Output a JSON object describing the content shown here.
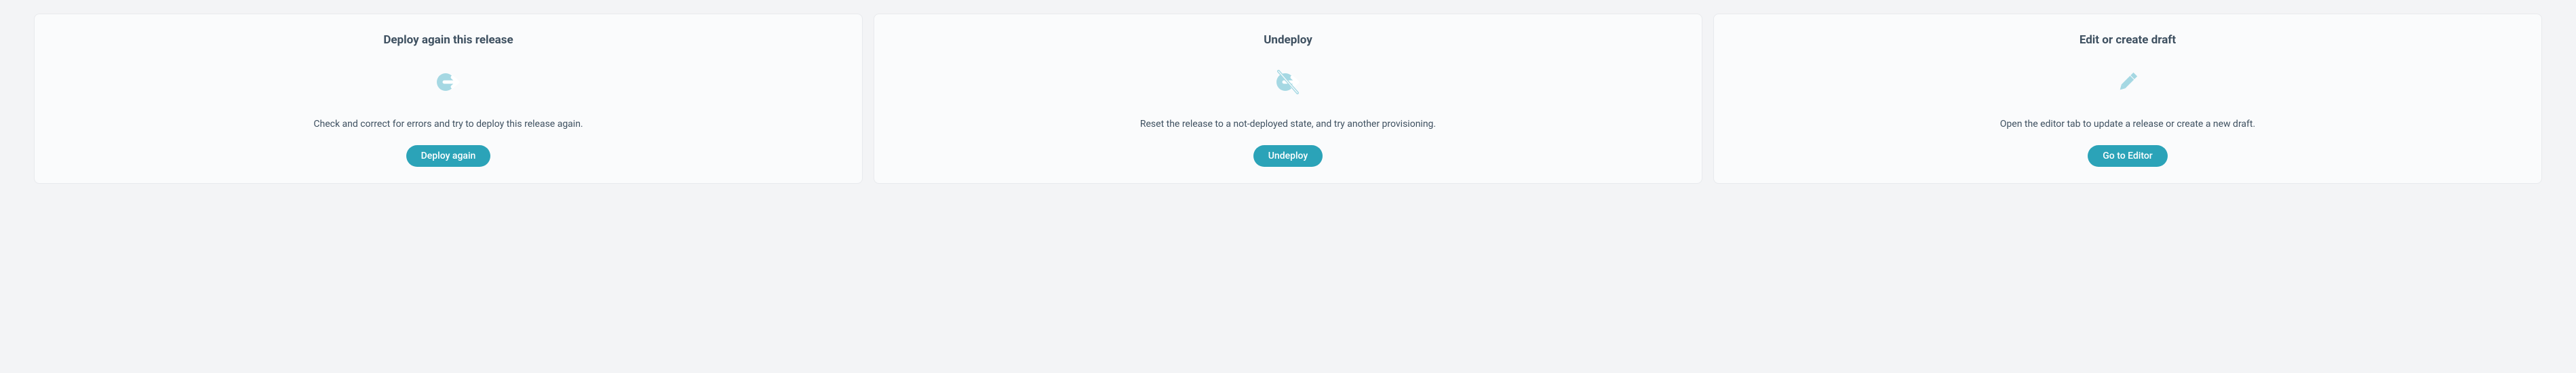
{
  "cards": [
    {
      "title": "Deploy again this release",
      "description": "Check and correct for errors and try to deploy this release again.",
      "button_label": "Deploy again"
    },
    {
      "title": "Undeploy",
      "description": "Reset the release to a not-deployed state, and try another provisioning.",
      "button_label": "Undeploy"
    },
    {
      "title": "Edit or create draft",
      "description": "Open the editor tab to update a release or create a new draft.",
      "button_label": "Go to Editor"
    }
  ],
  "colors": {
    "icon": "#a5d8e3",
    "button": "#2ba3b8"
  }
}
